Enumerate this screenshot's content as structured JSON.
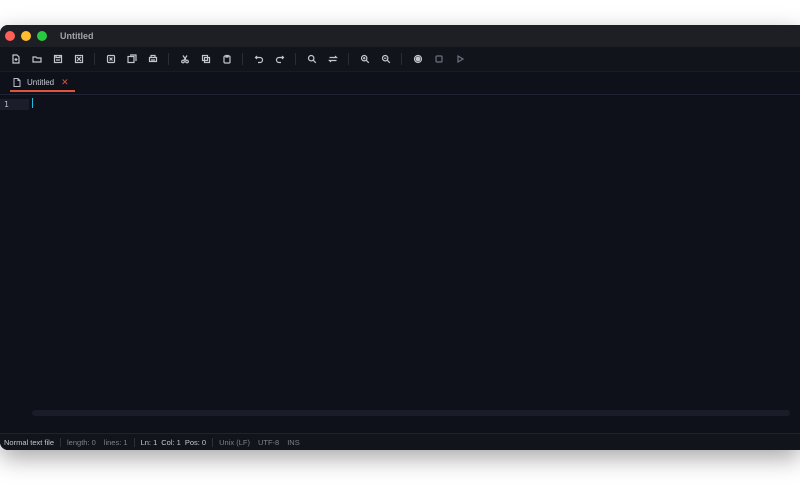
{
  "window": {
    "title": "Untitled"
  },
  "toolbar": {
    "groups": [
      [
        "new-file-icon",
        "open-folder-icon",
        "save-icon",
        "save-as-icon"
      ],
      [
        "close-file-icon",
        "close-all-icon",
        "print-icon"
      ],
      [
        "cut-icon",
        "copy-icon",
        "paste-icon"
      ],
      [
        "undo-icon",
        "redo-icon"
      ],
      [
        "search-icon",
        "replace-icon"
      ],
      [
        "zoom-in-icon",
        "zoom-out-icon"
      ],
      [
        "record-macro-icon",
        "stop-macro-icon",
        "play-macro-icon"
      ]
    ]
  },
  "tabs": [
    {
      "label": "Untitled",
      "close_glyph": "✕",
      "icon": "document-icon",
      "active_color": "#e0533d"
    }
  ],
  "editor": {
    "line_number": "1",
    "caret_color": "#27b9d9"
  },
  "status": {
    "file_type": "Normal text file",
    "length": "length: 0",
    "lines": "lines: 1",
    "ln": "Ln: 1",
    "col": "Col: 1",
    "pos": "Pos: 0",
    "eol": "Unix (LF)",
    "encoding": "UTF-8",
    "mode": "INS"
  }
}
